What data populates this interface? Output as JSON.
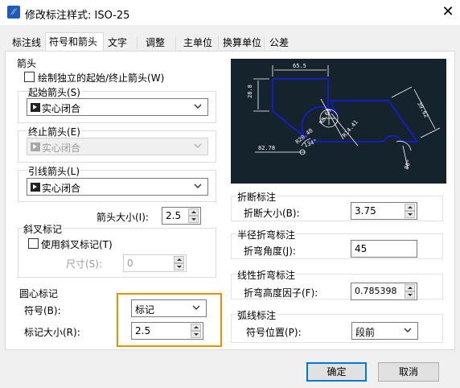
{
  "window": {
    "title": "修改标注样式: ISO-25",
    "app_icon": "app-icon",
    "close": "✕"
  },
  "tabs": [
    "标注线",
    "符号和箭头",
    "文字",
    "调整",
    "主单位",
    "换算单位",
    "公差"
  ],
  "arrows": {
    "group": "箭头",
    "independent_checkbox": "绘制独立的起始/终止箭头(W)",
    "start_label": "起始箭头(S)",
    "start_value": "实心闭合",
    "end_label": "终止箭头(E)",
    "end_value": "实心闭合",
    "leader_label": "引线箭头(L)",
    "leader_value": "实心闭合",
    "size_label": "箭头大小(I):",
    "size_value": "2.5"
  },
  "tick": {
    "group": "斜叉标记",
    "checkbox": "使用斜叉标记(T)",
    "size_label": "尺寸(S):",
    "size_value": "0"
  },
  "center_mark": {
    "group": "圆心标记",
    "symbol_label": "符号(B):",
    "symbol_value": "标记",
    "size_label": "标记大小(R):",
    "size_value": "2.5"
  },
  "preview": {
    "labels": [
      "65.5",
      "28.8",
      "39.62",
      "R8.68",
      "R14.41",
      "R20.48",
      "134°",
      "82.78",
      "80°"
    ]
  },
  "break": {
    "group": "折断标注",
    "size_label": "折断大小(B):",
    "size_value": "3.75"
  },
  "radius_jog": {
    "group": "半径折弯标注",
    "angle_label": "折弯角度(J):",
    "angle_value": "45"
  },
  "linear_jog": {
    "group": "线性折弯标注",
    "factor_label": "折弯高度因子(F):",
    "factor_value": "0.785398"
  },
  "arc_length": {
    "group": "弧线标注",
    "position_label": "符号位置(P):",
    "position_value": "段前"
  },
  "buttons": {
    "ok": "确定",
    "cancel": "取消"
  },
  "colors": {
    "accent_highlight": "#f08c00",
    "preview_bg": "#15232d",
    "preview_lines": "#1414c8"
  }
}
